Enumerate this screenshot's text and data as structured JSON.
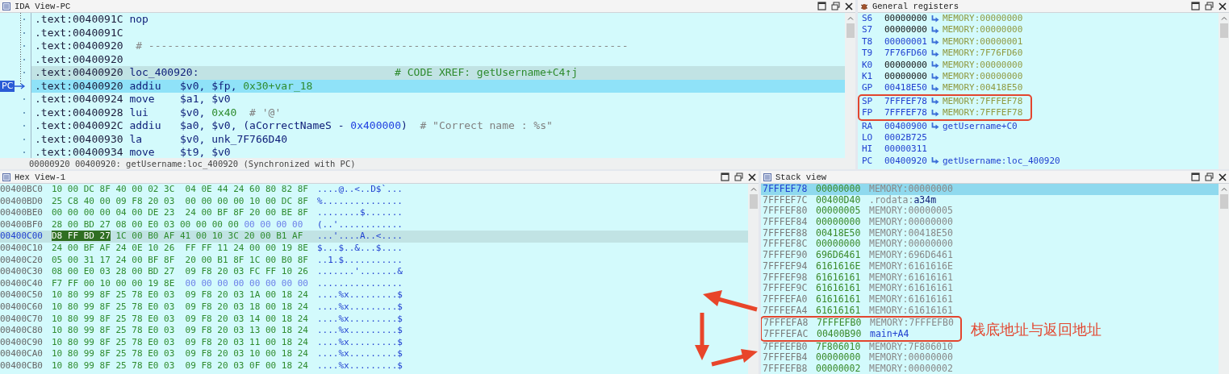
{
  "ida_view": {
    "title": "IDA View-PC",
    "pc_label": "PC",
    "lines": [
      {
        "address": ".text:0040091C",
        "mnemonic": "nop",
        "selected": false,
        "pc": false
      },
      {
        "address": ".text:0040091C",
        "selected": false,
        "pc": false
      },
      {
        "address": ".text:00400920",
        "comment": {
          "text": "# ----------------------------------------------------------------------------",
          "kind": "separator"
        },
        "selected": false,
        "pc": false
      },
      {
        "address": ".text:00400920",
        "selected": false,
        "pc": false
      },
      {
        "address": ".text:00400920",
        "mnemonic": "loc_400920:",
        "comment": {
          "text": "# CODE XREF: getUsername+C4↑j",
          "kind": "xref"
        },
        "selected": true,
        "pc": false
      },
      {
        "address": ".text:00400920",
        "mnemonic": "addiu",
        "operands": [
          {
            "text": "$v0",
            "kind": "reg"
          },
          {
            "text": ", ",
            "kind": "punct"
          },
          {
            "text": "$fp",
            "kind": "reg"
          },
          {
            "text": ", ",
            "kind": "punct"
          },
          {
            "text": "0x30+var_18",
            "kind": "num"
          }
        ],
        "selected": false,
        "pc": true
      },
      {
        "address": ".text:00400924",
        "mnemonic": "move",
        "operands": [
          {
            "text": "$a1",
            "kind": "reg"
          },
          {
            "text": ", ",
            "kind": "punct"
          },
          {
            "text": "$v0",
            "kind": "reg"
          }
        ],
        "selected": false,
        "pc": false
      },
      {
        "address": ".text:00400928",
        "mnemonic": "lui",
        "operands": [
          {
            "text": "$v0",
            "kind": "reg"
          },
          {
            "text": ", ",
            "kind": "punct"
          },
          {
            "text": "0x40",
            "kind": "num"
          }
        ],
        "comment": {
          "text": "# '@'",
          "kind": "note"
        },
        "selected": false,
        "pc": false
      },
      {
        "address": ".text:0040092C",
        "mnemonic": "addiu",
        "operands": [
          {
            "text": "$a0",
            "kind": "reg"
          },
          {
            "text": ", ",
            "kind": "punct"
          },
          {
            "text": "$v0",
            "kind": "reg"
          },
          {
            "text": ", (",
            "kind": "punct"
          },
          {
            "text": "aCorrectNameS",
            "kind": "reg"
          },
          {
            "text": " - ",
            "kind": "punct"
          },
          {
            "text": "0x400000",
            "kind": "const"
          },
          {
            "text": ")",
            "kind": "punct"
          }
        ],
        "comment": {
          "text": "# \"Correct name : %s\"",
          "kind": "note"
        },
        "selected": false,
        "pc": false
      },
      {
        "address": ".text:00400930",
        "mnemonic": "la",
        "operands": [
          {
            "text": "$v0",
            "kind": "reg"
          },
          {
            "text": ", ",
            "kind": "punct"
          },
          {
            "text": "unk_7F766D40",
            "kind": "reg"
          }
        ],
        "selected": false,
        "pc": false
      },
      {
        "address": ".text:00400934",
        "mnemonic": "move",
        "operands": [
          {
            "text": "$t9",
            "kind": "reg"
          },
          {
            "text": ", ",
            "kind": "punct"
          },
          {
            "text": "$v0",
            "kind": "reg"
          }
        ],
        "selected": false,
        "pc": false
      }
    ],
    "status": "00000920 00400920: getUsername:loc_400920 (Synchronized with PC)"
  },
  "registers": {
    "title": "General registers",
    "rows": [
      {
        "name": "S6",
        "value": "00000000",
        "target": "MEMORY:00000000",
        "kind": "memory",
        "changed": false,
        "boxed": false
      },
      {
        "name": "S7",
        "value": "00000000",
        "target": "MEMORY:00000000",
        "kind": "memory",
        "changed": false,
        "boxed": false
      },
      {
        "name": "T8",
        "value": "00000001",
        "target": "MEMORY:00000001",
        "kind": "memory",
        "changed": true,
        "boxed": false
      },
      {
        "name": "T9",
        "value": "7F76FD60",
        "target": "MEMORY:7F76FD60",
        "kind": "memory",
        "changed": true,
        "boxed": false
      },
      {
        "name": "K0",
        "value": "00000000",
        "target": "MEMORY:00000000",
        "kind": "memory",
        "changed": false,
        "boxed": false
      },
      {
        "name": "K1",
        "value": "00000000",
        "target": "MEMORY:00000000",
        "kind": "memory",
        "changed": false,
        "boxed": false
      },
      {
        "name": "GP",
        "value": "00418E50",
        "target": "MEMORY:00418E50",
        "kind": "memory",
        "changed": true,
        "boxed": false
      },
      {
        "name": "SP",
        "value": "7FFFEF78",
        "target": "MEMORY:7FFFEF78",
        "kind": "memory",
        "changed": true,
        "boxed": true
      },
      {
        "name": "FP",
        "value": "7FFFEF78",
        "target": "MEMORY:7FFFEF78",
        "kind": "memory",
        "changed": true,
        "boxed": true
      },
      {
        "name": "RA",
        "value": "00400900",
        "target": "getUsername+C0",
        "kind": "symbol",
        "changed": true,
        "boxed": false
      },
      {
        "name": "LO",
        "value": "0002B725",
        "changed": true,
        "boxed": false
      },
      {
        "name": "HI",
        "value": "00000311",
        "changed": true,
        "boxed": false
      },
      {
        "name": "PC",
        "value": "00400920",
        "target": "getUsername:loc_400920",
        "kind": "symbol",
        "changed": true,
        "boxed": false
      }
    ]
  },
  "hex_view": {
    "title": "Hex View-1",
    "rows": [
      {
        "address": "00400BC0",
        "segments": [
          {
            "text": "10 00 DC 8F 40 00 02 3C",
            "kind": "data"
          },
          {
            "text": "04 0E 44 24 60 80 82 8F",
            "kind": "data"
          }
        ],
        "ascii": "....@..<..D$`...",
        "selected": false
      },
      {
        "address": "00400BD0",
        "segments": [
          {
            "text": "25 C8 40 00 09 F8 20 03",
            "kind": "data"
          },
          {
            "text": "00 00 00 00 10 00 DC 8F",
            "kind": "data"
          }
        ],
        "ascii": "%...............",
        "selected": false
      },
      {
        "address": "00400BE0",
        "segments": [
          {
            "text": "00 00 00 00 04 00 DE 23",
            "kind": "data"
          },
          {
            "text": "24 00 BF 8F 20 00 BE 8F",
            "kind": "data"
          }
        ],
        "ascii": "........$.......",
        "selected": false
      },
      {
        "address": "00400BF0",
        "segments": [
          {
            "text": "28 00 BD 27 08 00 E0 03",
            "kind": "data"
          },
          {
            "text": "00 00 00 00",
            "kind": "data"
          },
          {
            "text": "00 00 00 00",
            "kind": "unloaded"
          }
        ],
        "ascii": "(..'............",
        "selected": false
      },
      {
        "address": "00400C00",
        "segments": [
          {
            "text": "D8 FF BD 27",
            "kind": "selected"
          },
          {
            "text": "1C 00 B0 AF",
            "kind": "data"
          },
          {
            "text": "41 00 10 3C 20 00 B1 AF",
            "kind": "data"
          }
        ],
        "ascii": "...'....A..<....",
        "selected": true
      },
      {
        "address": "00400C10",
        "segments": [
          {
            "text": "24 00 BF AF 24 0E 10 26",
            "kind": "data"
          },
          {
            "text": "FF FF 11 24 00 00 19 8E",
            "kind": "data"
          }
        ],
        "ascii": "$...$..&...$....",
        "selected": false
      },
      {
        "address": "00400C20",
        "segments": [
          {
            "text": "05 00 31 17 24 00 BF 8F",
            "kind": "data"
          },
          {
            "text": "20 00 B1 8F 1C 00 B0 8F",
            "kind": "data"
          }
        ],
        "ascii": "..1.$...........",
        "selected": false
      },
      {
        "address": "00400C30",
        "segments": [
          {
            "text": "08 00 E0 03 28 00 BD 27",
            "kind": "data"
          },
          {
            "text": "09 F8 20 03 FC FF 10 26",
            "kind": "data"
          }
        ],
        "ascii": ".......'.......&",
        "selected": false
      },
      {
        "address": "00400C40",
        "segments": [
          {
            "text": "F7 FF 00 10 00 00 19 8E",
            "kind": "data"
          },
          {
            "text": "00 00 00 00 00 00 00 00",
            "kind": "unloaded"
          }
        ],
        "ascii": "................",
        "selected": false
      },
      {
        "address": "00400C50",
        "segments": [
          {
            "text": "10 80 99 8F 25 78 E0 03",
            "kind": "data"
          },
          {
            "text": "09 F8 20 03 1A 00 18 24",
            "kind": "data"
          }
        ],
        "ascii": "....%x.........$",
        "selected": false
      },
      {
        "address": "00400C60",
        "segments": [
          {
            "text": "10 80 99 8F 25 78 E0 03",
            "kind": "data"
          },
          {
            "text": "09 F8 20 03 18 00 18 24",
            "kind": "data"
          }
        ],
        "ascii": "....%x.........$",
        "selected": false
      },
      {
        "address": "00400C70",
        "segments": [
          {
            "text": "10 80 99 8F 25 78 E0 03",
            "kind": "data"
          },
          {
            "text": "09 F8 20 03 14 00 18 24",
            "kind": "data"
          }
        ],
        "ascii": "....%x.........$",
        "selected": false
      },
      {
        "address": "00400C80",
        "segments": [
          {
            "text": "10 80 99 8F 25 78 E0 03",
            "kind": "data"
          },
          {
            "text": "09 F8 20 03 13 00 18 24",
            "kind": "data"
          }
        ],
        "ascii": "....%x.........$",
        "selected": false
      },
      {
        "address": "00400C90",
        "segments": [
          {
            "text": "10 80 99 8F 25 78 E0 03",
            "kind": "data"
          },
          {
            "text": "09 F8 20 03 11 00 18 24",
            "kind": "data"
          }
        ],
        "ascii": "....%x.........$",
        "selected": false
      },
      {
        "address": "00400CA0",
        "segments": [
          {
            "text": "10 80 99 8F 25 78 E0 03",
            "kind": "data"
          },
          {
            "text": "09 F8 20 03 10 00 18 24",
            "kind": "data"
          }
        ],
        "ascii": "....%x.........$",
        "selected": false
      },
      {
        "address": "00400CB0",
        "segments": [
          {
            "text": "10 80 99 8F 25 78 E0 03",
            "kind": "data"
          },
          {
            "text": "09 F8 20 03 0F 00 18 24",
            "kind": "data"
          }
        ],
        "ascii": "....%x.........$",
        "selected": false
      }
    ]
  },
  "stack_view": {
    "title": "Stack view",
    "rows": [
      {
        "address": "7FFFEF78",
        "value": "00000000",
        "target": "MEMORY:00000000",
        "kind": "memory",
        "selected": true,
        "boxed": false
      },
      {
        "address": "7FFFEF7C",
        "value": "00400D40",
        "segment": ".rodata:",
        "target": "a34m",
        "kind": "segment",
        "selected": false,
        "boxed": false
      },
      {
        "address": "7FFFEF80",
        "value": "00000005",
        "target": "MEMORY:00000005",
        "kind": "memory",
        "selected": false,
        "boxed": false
      },
      {
        "address": "7FFFEF84",
        "value": "00000000",
        "target": "MEMORY:00000000",
        "kind": "memory",
        "selected": false,
        "boxed": false
      },
      {
        "address": "7FFFEF88",
        "value": "00418E50",
        "target": "MEMORY:00418E50",
        "kind": "memory",
        "selected": false,
        "boxed": false
      },
      {
        "address": "7FFFEF8C",
        "value": "00000000",
        "target": "MEMORY:00000000",
        "kind": "memory",
        "selected": false,
        "boxed": false
      },
      {
        "address": "7FFFEF90",
        "value": "696D6461",
        "target": "MEMORY:696D6461",
        "kind": "memory",
        "selected": false,
        "boxed": false
      },
      {
        "address": "7FFFEF94",
        "value": "6161616E",
        "target": "MEMORY:6161616E",
        "kind": "memory",
        "selected": false,
        "boxed": false
      },
      {
        "address": "7FFFEF98",
        "value": "61616161",
        "target": "MEMORY:61616161",
        "kind": "memory",
        "selected": false,
        "boxed": false
      },
      {
        "address": "7FFFEF9C",
        "value": "61616161",
        "target": "MEMORY:61616161",
        "kind": "memory",
        "selected": false,
        "boxed": false
      },
      {
        "address": "7FFFEFA0",
        "value": "61616161",
        "target": "MEMORY:61616161",
        "kind": "memory",
        "selected": false,
        "boxed": false
      },
      {
        "address": "7FFFEFA4",
        "value": "61616161",
        "target": "MEMORY:61616161",
        "kind": "memory",
        "selected": false,
        "boxed": false
      },
      {
        "address": "7FFFEFA8",
        "value": "7FFFEFB0",
        "target": "MEMORY:7FFFEFB0",
        "kind": "memory",
        "selected": false,
        "boxed": true
      },
      {
        "address": "7FFFEFAC",
        "value": "00400B90",
        "target": "main+A4",
        "kind": "symbol",
        "selected": false,
        "boxed": true
      },
      {
        "address": "7FFFEFB0",
        "value": "7F806010",
        "target": "MEMORY:7F806010",
        "kind": "memory",
        "selected": false,
        "boxed": false
      },
      {
        "address": "7FFFEFB4",
        "value": "00000000",
        "target": "MEMORY:00000000",
        "kind": "memory",
        "selected": false,
        "boxed": false
      },
      {
        "address": "7FFFEFB8",
        "value": "00000002",
        "target": "MEMORY:00000002",
        "kind": "memory",
        "selected": false,
        "boxed": false
      }
    ]
  },
  "annotation": {
    "label": "栈底地址与返回地址"
  }
}
